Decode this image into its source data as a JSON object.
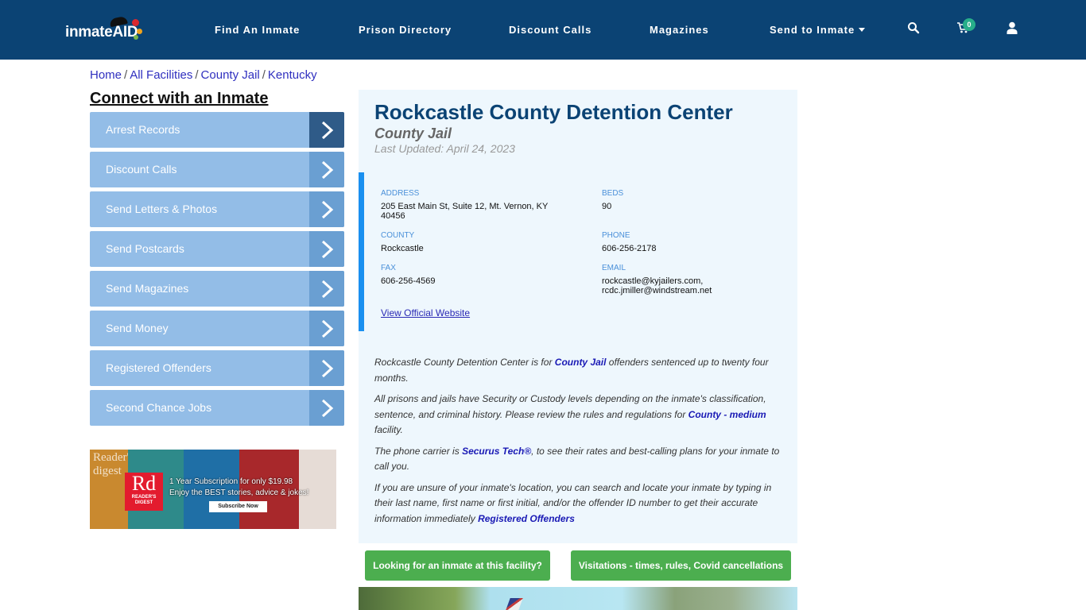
{
  "brand": {
    "logo_text": "inmateAID",
    "nav_bg": "#0b4374"
  },
  "nav": {
    "items": [
      {
        "label": "Find An Inmate"
      },
      {
        "label": "Prison Directory"
      },
      {
        "label": "Discount Calls"
      },
      {
        "label": "Magazines"
      },
      {
        "label": "Send to Inmate",
        "dropdown": true
      }
    ],
    "icons": [
      "search-icon",
      "cart-icon",
      "user-icon"
    ],
    "cart_count": "0"
  },
  "breadcrumb": {
    "items": [
      "Home",
      "All Facilities",
      "County Jail",
      "Kentucky"
    ],
    "separator": "/"
  },
  "sidebar": {
    "title": "Connect with an Inmate",
    "items": [
      {
        "label": "Arrest Records",
        "active": true
      },
      {
        "label": "Discount Calls"
      },
      {
        "label": "Send Letters & Photos"
      },
      {
        "label": "Send Postcards"
      },
      {
        "label": "Send Magazines"
      },
      {
        "label": "Send Money"
      },
      {
        "label": "Registered Offenders"
      },
      {
        "label": "Second Chance Jobs"
      }
    ],
    "ad": {
      "masthead": "Reader's digest",
      "logo_big": "Rd",
      "logo_small": "READER'S DIGEST",
      "line1": "1 Year Subscription for only $19.98",
      "line2": "Enjoy the BEST stories, advice & jokes!",
      "button": "Subscribe Now"
    }
  },
  "facility": {
    "name": "Rockcastle County Detention Center",
    "type": "County Jail",
    "last_updated": "Last Updated: April 24, 2023",
    "info": {
      "address_label": "ADDRESS",
      "address_line1": "205 East Main St, Suite 12, Mt. Vernon, KY",
      "address_line2": "40456",
      "beds_label": "BEDS",
      "beds": "90",
      "county_label": "COUNTY",
      "county": "Rockcastle",
      "phone_label": "PHONE",
      "phone": "606-256-2178",
      "fax_label": "FAX",
      "fax": "606-256-4569",
      "email_label": "EMAIL",
      "email_line1": "rockcastle@kyjailers.com,",
      "email_line2": "rcdc.jmiller@windstream.net",
      "website_link": "View Official Website"
    },
    "description": {
      "p1_pre": "Rockcastle County Detention Center is for ",
      "p1_link": "County Jail",
      "p1_post": " offenders sentenced up to twenty four months.",
      "p2_pre": "All prisons and jails have Security or Custody levels depending on the inmate's classification, sentence, and criminal history. Please review the rules and regulations for ",
      "p2_link": "County - medium",
      "p2_post": " facility.",
      "p3_pre": "The phone carrier is ",
      "p3_link": "Securus Tech®",
      "p3_post": ", to see their rates and best-calling plans for your inmate to call you.",
      "p4_pre": "If you are unsure of your inmate's location, you can search and locate your inmate by typing in their last name, first name or first initial, and/or the offender ID number to get their accurate information immediately ",
      "p4_link": "Registered Offenders"
    }
  },
  "actions": {
    "find_inmate": "Looking for an inmate at this facility?",
    "visitations": "Visitations - times, rules, Covid cancellations"
  }
}
